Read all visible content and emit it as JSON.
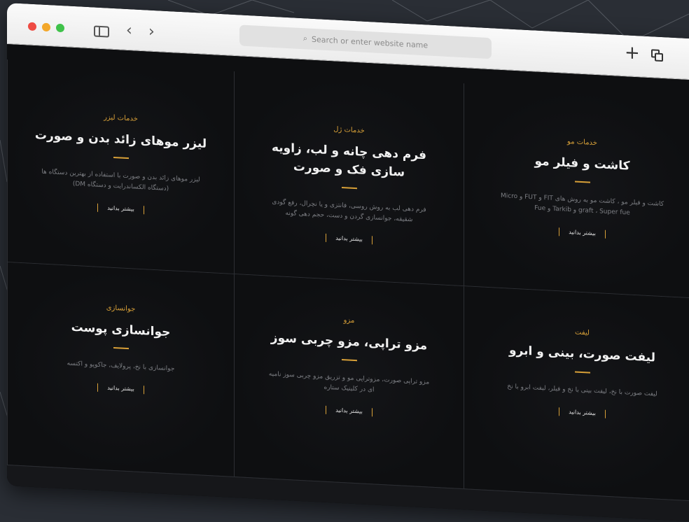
{
  "browser": {
    "address_placeholder": "Search or enter website name"
  },
  "services": [
    {
      "category": "خدمات مو",
      "title": "کاشت و فیلر مو",
      "description": "کاشت و فیلر مو ، کاشت مو به روش های FIT و FUT و Micro graft ، Super fue و Tarkib و Fue",
      "button": "بیشتر بدانید"
    },
    {
      "category": "خدمات ژل",
      "title": "فرم دهی چانه و لب، زاویه سازی فک و صورت",
      "description": "فرم دهی لب به روش روسی، فانتزی و یا نچرال، رفع گودی شقیقه، جوانسازی گردن و دست، حجم دهی گونه",
      "button": "بیشتر بدانید"
    },
    {
      "category": "خدمات لیزر",
      "title": "لیزر موهای زائد بدن و صورت",
      "description": "لیزر موهای زائد بدن و صورت با استفاده از بهترین دستگاه ها (دستگاه الکساندرایت و دستگاه DM)",
      "button": "بیشتر بدانید"
    },
    {
      "category": "لیفت",
      "title": "لیفت صورت، بینی و ابرو",
      "description": "لیفت صورت با نخ، لیفت بینی با نخ و فیلر، لیفت ابرو با نخ",
      "button": "بیشتر بدانید"
    },
    {
      "category": "مزو",
      "title": "مزو تراپی، مزو چربی سوز",
      "description": "مزو تراپی صورت، مزوتراپی مو و تزریق مزو چربی سوز نامیه ای در کلینیک ستاره",
      "button": "بیشتر بدانید"
    },
    {
      "category": "جوانسازی",
      "title": "جوانسازی پوست",
      "description": "جوانسازی با نخ، پرولایف، جاکوپو و اکتسه",
      "button": "بیشتر بدانید"
    }
  ]
}
